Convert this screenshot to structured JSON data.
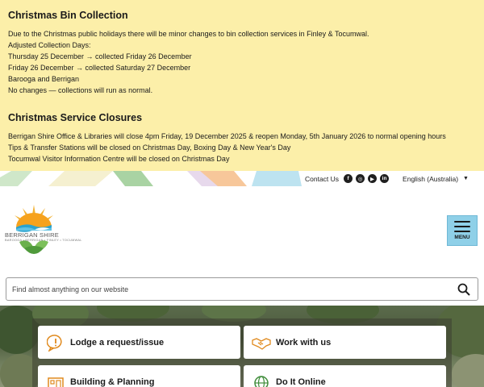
{
  "notice": {
    "title1": "Christmas Bin Collection",
    "lines1": [
      "Due to the Christmas public holidays there will be minor changes to bin collection services in Finley & Tocumwal.",
      "Adjusted Collection Days:",
      "Thursday 25 December → collected Friday 26 December",
      "Friday 26 December → collected Saturday 27 December",
      "Barooga and Berrigan",
      "No changes — collections will run as normal."
    ],
    "title2": "Christmas Service Closures",
    "lines2": [
      "Berrigan Shire Office & Libraries will close 4pm Friday, 19 December 2025 & reopen Monday, 5th January 2026 to normal opening hours",
      "Tips & Transfer Stations will be closed on Christmas Day, Boxing Day & New Year's Day",
      "Tocumwal Visitor Information Centre will be closed on Christmas Day"
    ]
  },
  "utility": {
    "contact_label": "Contact Us",
    "language": "English (Australia)",
    "social_icons": [
      "facebook-icon",
      "instagram-icon",
      "youtube-icon",
      "linkedin-icon"
    ]
  },
  "logo": {
    "name": "BERRIGAN SHIRE",
    "towns": "BAROOGA • BERRIGAN • FINLEY • TOCUMWAL"
  },
  "menu": {
    "label": "MENU"
  },
  "search": {
    "placeholder": "Find almost anything on our website"
  },
  "cards": [
    {
      "label": "Lodge a request/issue",
      "icon": "alert-icon"
    },
    {
      "label": "Work with us",
      "icon": "handshake-icon"
    },
    {
      "label": "Building & Planning",
      "icon": "building-icon"
    },
    {
      "label": "Do It Online",
      "icon": "globe-icon"
    }
  ],
  "colors": {
    "notice_bg": "#fcefa9",
    "menu_bg": "#8fd0e8",
    "icon_orange": "#e08a1e",
    "icon_green": "#3f8c3a"
  }
}
